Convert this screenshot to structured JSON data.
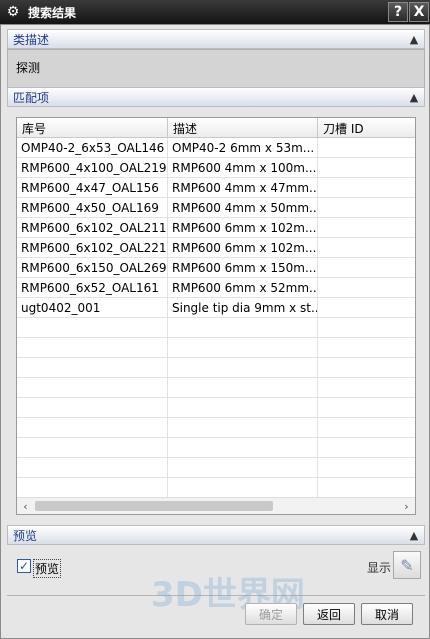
{
  "window": {
    "title": "搜索结果",
    "help_label": "?",
    "close_label": "X"
  },
  "category": {
    "header": "类描述",
    "value": "探测"
  },
  "match": {
    "header": "匹配项",
    "columns": [
      "库号",
      "描述",
      "刀槽 ID"
    ],
    "rows": [
      [
        "OMP40-2_6x53_OAL146",
        "OMP40-2 6mm x 53m...",
        ""
      ],
      [
        "RMP600_4x100_OAL219",
        "RMP600 4mm x 100m...",
        ""
      ],
      [
        "RMP600_4x47_OAL156",
        "RMP600 4mm x 47mm...",
        ""
      ],
      [
        "RMP600_4x50_OAL169",
        "RMP600 4mm x 50mm...",
        ""
      ],
      [
        "RMP600_6x102_OAL211",
        "RMP600 6mm x 102m...",
        ""
      ],
      [
        "RMP600_6x102_OAL221",
        "RMP600 6mm x 102m...",
        ""
      ],
      [
        "RMP600_6x150_OAL269",
        "RMP600 6mm x 150m...",
        ""
      ],
      [
        "RMP600_6x52_OAL161",
        "RMP600 6mm x 52mm...",
        ""
      ],
      [
        "ugt0402_001",
        "Single tip dia 9mm x st...",
        ""
      ]
    ],
    "empty_rows": 9
  },
  "preview": {
    "header": "预览",
    "checkbox_label": "预览",
    "checked": true,
    "show_label": "显示"
  },
  "buttons": {
    "ok": "确定",
    "back": "返回",
    "cancel": "取消"
  },
  "watermark": "3D世界网",
  "colors": {
    "title_bg": "#1e1e1e",
    "header_text": "#1d3d8f"
  }
}
